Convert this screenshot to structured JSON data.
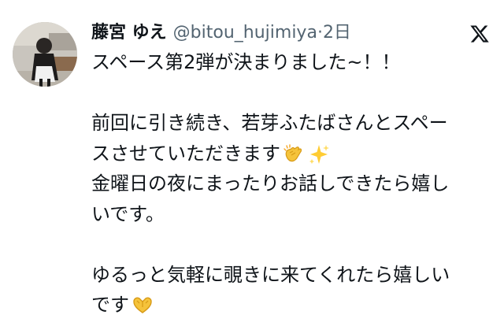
{
  "tweet": {
    "display_name": "藤宮 ゆえ",
    "handle": "@bitou_hujimiya",
    "separator": "·",
    "timestamp": "2日",
    "body_lines": [
      "スペース第2弾が決まりました~！！",
      "",
      "前回に引き続き、若芽ふたばさんとスペー",
      "スさせていただきます",
      "金曜日の夜にまったりお話しできたら嬉し",
      "いです。",
      "",
      "ゆるっと気軽に覗きに来てくれたら嬉しい",
      "です"
    ],
    "emojis": [
      "clapping-hands-icon",
      "sparkles-icon",
      "heart-hands-icon"
    ],
    "platform_icon": "x-logo-icon"
  },
  "colors": {
    "text": "#0f1419",
    "muted": "#536471",
    "background": "#ffffff",
    "clap": "#f5c33b",
    "sparkle": "#ffcc33"
  }
}
